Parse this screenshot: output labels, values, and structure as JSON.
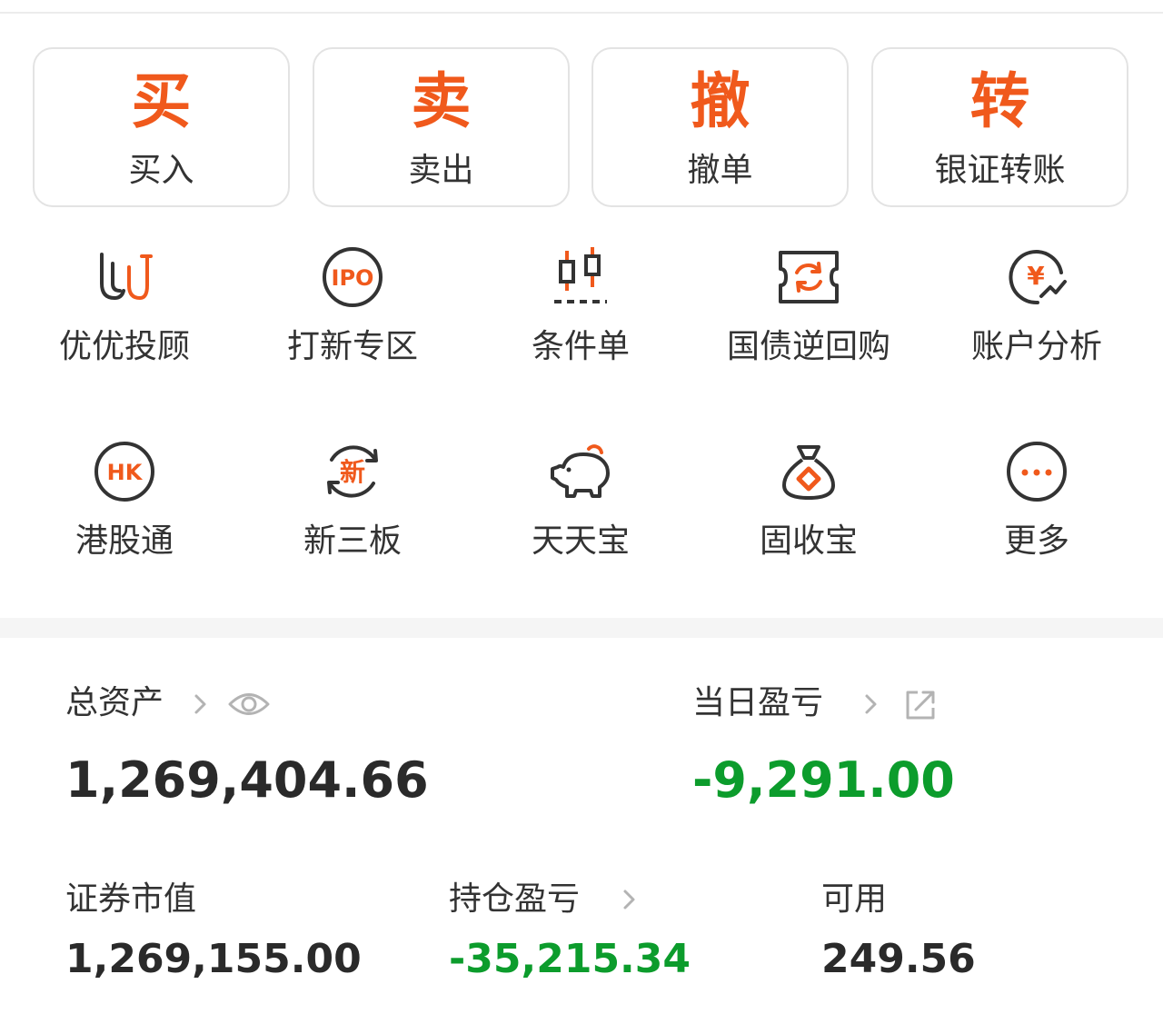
{
  "colors": {
    "accent": "#f0591c",
    "text": "#333333",
    "loss": "#0c9c2c",
    "muted": "#b3b3b3"
  },
  "actions": [
    {
      "char": "买",
      "label": "买入"
    },
    {
      "char": "卖",
      "label": "卖出"
    },
    {
      "char": "撤",
      "label": "撤单"
    },
    {
      "char": "转",
      "label": "银证转账"
    }
  ],
  "features": [
    {
      "label": "优优投顾",
      "icon": "youyou-advisor-icon"
    },
    {
      "label": "打新专区",
      "icon": "ipo-icon",
      "icon_text": "IPO"
    },
    {
      "label": "条件单",
      "icon": "candlestick-icon"
    },
    {
      "label": "国债逆回购",
      "icon": "ticket-refresh-icon"
    },
    {
      "label": "账户分析",
      "icon": "yen-chart-icon",
      "icon_text": "¥"
    },
    {
      "label": "港股通",
      "icon": "hk-icon",
      "icon_text": "HK"
    },
    {
      "label": "新三板",
      "icon": "new-board-icon",
      "icon_text": "新"
    },
    {
      "label": "天天宝",
      "icon": "piggy-bank-icon"
    },
    {
      "label": "固收宝",
      "icon": "money-bag-icon"
    },
    {
      "label": "更多",
      "icon": "more-icon"
    }
  ],
  "assets": {
    "total_label": "总资产",
    "total_value": "1,269,404.66",
    "daily_pnl_label": "当日盈亏",
    "daily_pnl_value": "-9,291.00",
    "market_value_label": "证券市值",
    "market_value": "1,269,155.00",
    "holding_pnl_label": "持仓盈亏",
    "holding_pnl_value": "-35,215.34",
    "available_label": "可用",
    "available_value": "249.56"
  }
}
